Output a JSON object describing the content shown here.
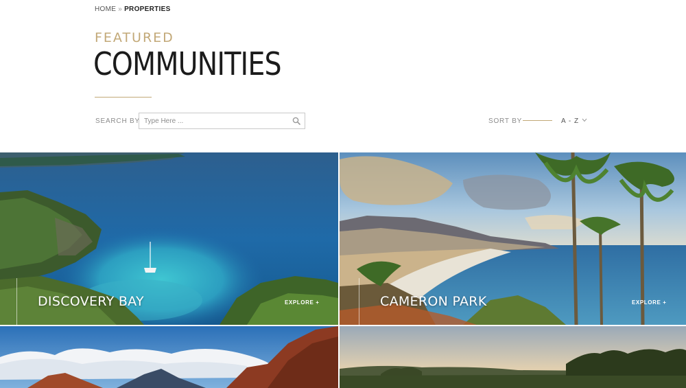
{
  "breadcrumb": {
    "home": "HOME",
    "separator": "»",
    "current": "PROPERTIES"
  },
  "header": {
    "eyebrow": "FEATURED",
    "title": "COMMUNITIES"
  },
  "search": {
    "label": "SEARCH BY",
    "placeholder": "Type Here ...",
    "value": ""
  },
  "sort": {
    "label": "SORT BY",
    "selected": "A - Z"
  },
  "accent_color": "#c2a877",
  "communities": [
    {
      "name": "DISCOVERY BAY",
      "explore": "EXPLORE +"
    },
    {
      "name": "CAMERON PARK",
      "explore": "EXPLORE +"
    },
    {
      "name": "",
      "explore": ""
    },
    {
      "name": "",
      "explore": ""
    }
  ]
}
